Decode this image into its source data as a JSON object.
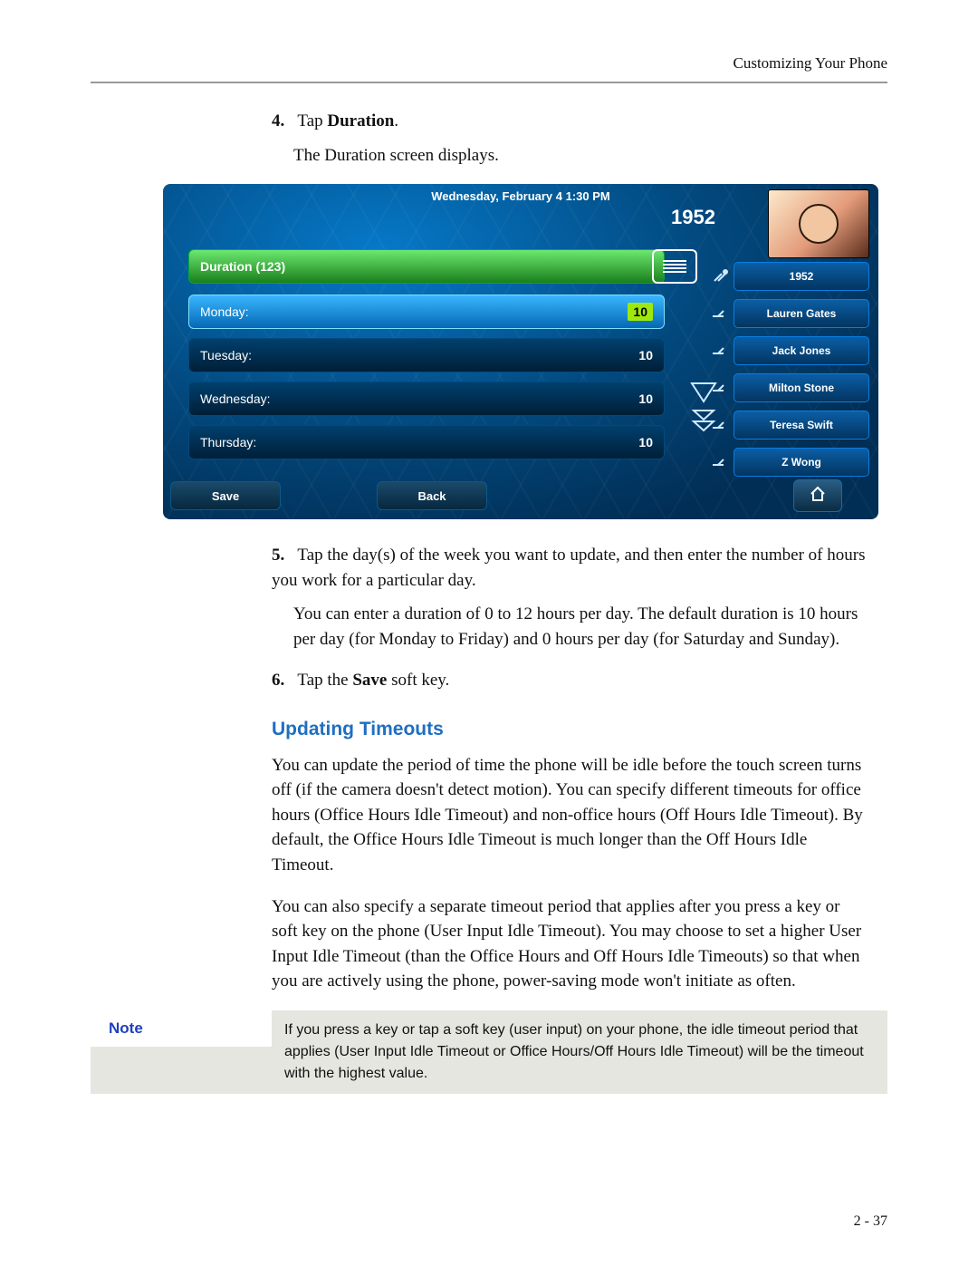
{
  "running_head": "Customizing Your Phone",
  "page_number": "2 - 37",
  "steps": {
    "s4_num": "4.",
    "s4_text_a": "Tap ",
    "s4_bold": "Duration",
    "s4_text_b": ".",
    "s4_follow": "The Duration screen displays.",
    "s5_num": "5.",
    "s5_text": "Tap the day(s) of the week you want to update, and then enter the number of hours you work for a particular day.",
    "s5_follow": "You can enter a duration of 0 to 12 hours per day. The default duration is 10 hours per day (for Monday to Friday) and 0 hours per day (for Saturday and Sunday).",
    "s6_num": "6.",
    "s6_text_a": "Tap the ",
    "s6_bold": "Save",
    "s6_text_b": " soft key."
  },
  "section_heading": "Updating Timeouts",
  "section_p1": "You can update the period of time the phone will be idle before the touch screen turns off (if the camera doesn't detect motion). You can specify different timeouts for office hours (Office Hours Idle Timeout) and non-office hours (Off Hours Idle Timeout). By default, the Office Hours Idle Timeout is much longer than the Off Hours Idle Timeout.",
  "section_p2": "You can also specify a separate timeout period that applies after you press a key or soft key on the phone (User Input Idle Timeout). You may choose to set a higher User Input Idle Timeout (than the Office Hours and Off Hours Idle Timeouts) so that when you are actively using the phone, power-saving mode won't initiate as often.",
  "note_label": "Note",
  "note_body": "If you press a key or tap a soft key (user input) on your phone, the idle timeout period that applies (User Input Idle Timeout or Office Hours/Off Hours Idle Timeout) will be the timeout with the highest value.",
  "screen": {
    "datetime": "Wednesday, February 4  1:30 PM",
    "extension": "1952",
    "header": "Duration (123)",
    "rows": [
      {
        "label": "Monday:",
        "value": "10",
        "selected": true
      },
      {
        "label": "Tuesday:",
        "value": "10",
        "selected": false
      },
      {
        "label": "Wednesday:",
        "value": "10",
        "selected": false
      },
      {
        "label": "Thursday:",
        "value": "10",
        "selected": false
      }
    ],
    "side": [
      "1952",
      "Lauren Gates",
      "Jack Jones",
      "Milton Stone",
      "Teresa Swift",
      "Z Wong"
    ],
    "soft_save": "Save",
    "soft_back": "Back"
  }
}
